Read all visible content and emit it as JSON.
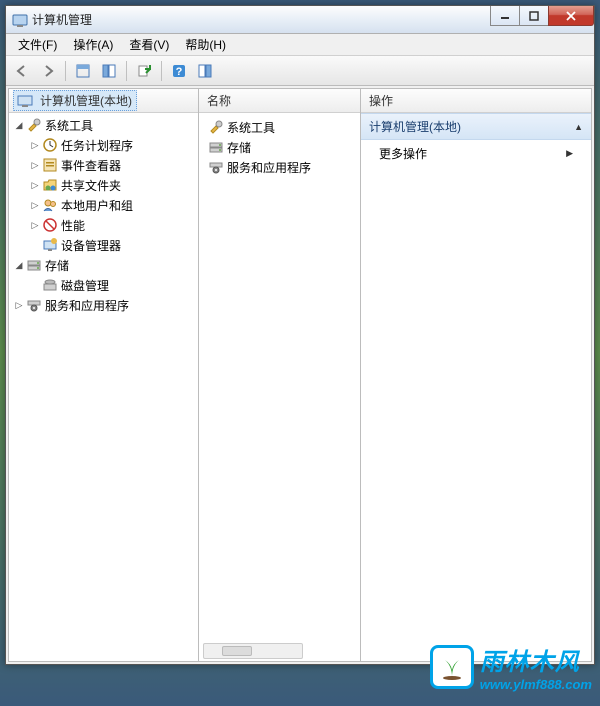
{
  "window": {
    "title": "计算机管理"
  },
  "menubar": {
    "file": "文件(F)",
    "action": "操作(A)",
    "view": "查看(V)",
    "help": "帮助(H)"
  },
  "tree": {
    "root": "计算机管理(本地)",
    "system_tools": "系统工具",
    "task_scheduler": "任务计划程序",
    "event_viewer": "事件查看器",
    "shared_folders": "共享文件夹",
    "local_users": "本地用户和组",
    "performance": "性能",
    "device_manager": "设备管理器",
    "storage": "存储",
    "disk_management": "磁盘管理",
    "services_apps": "服务和应用程序"
  },
  "mid": {
    "header": "名称",
    "items": {
      "system_tools": "系统工具",
      "storage": "存储",
      "services_apps": "服务和应用程序"
    }
  },
  "right": {
    "header": "操作",
    "group": "计算机管理(本地)",
    "more": "更多操作"
  },
  "watermark": {
    "line1": "雨林木风",
    "line2": "www.ylmf888.com"
  }
}
